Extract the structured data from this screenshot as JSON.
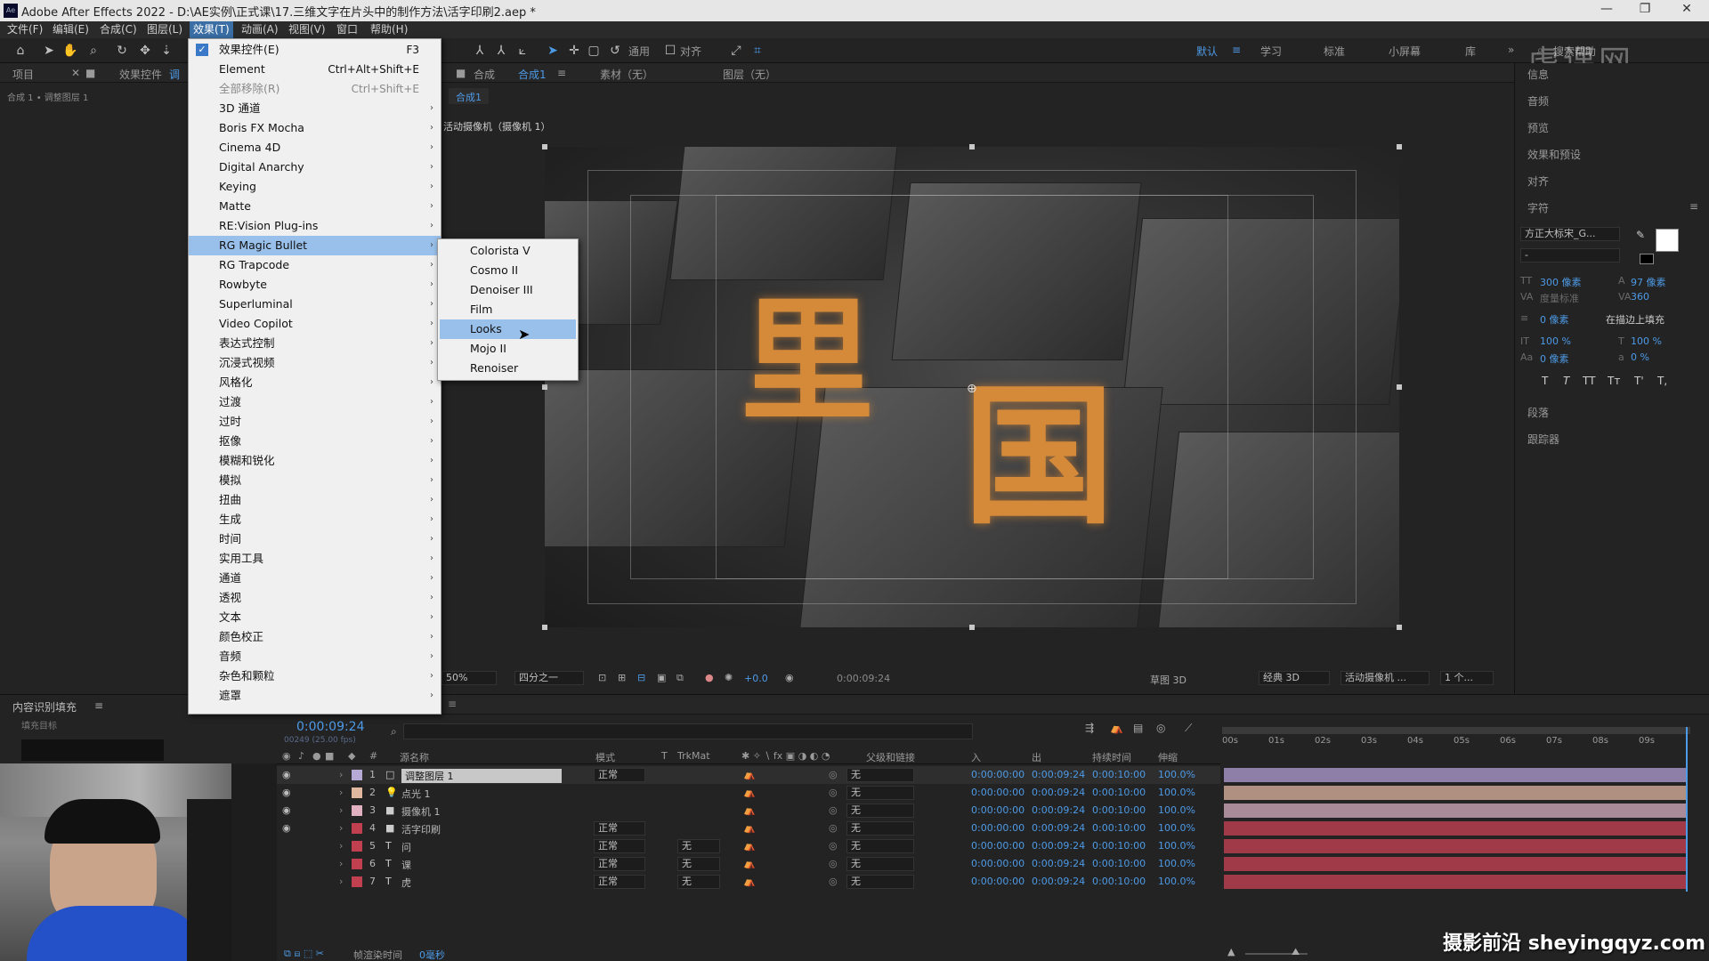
{
  "window": {
    "title": "Adobe After Effects 2022 - D:\\AE实例\\正式课\\17.三维文字在片头中的制作方法\\活字印刷2.aep *",
    "controls": [
      "—",
      "❐",
      "✕"
    ]
  },
  "menubar": {
    "items": [
      "文件(F)",
      "编辑(E)",
      "合成(C)",
      "图层(L)",
      "效果(T)",
      "动画(A)",
      "视图(V)",
      "窗口",
      "帮助(H)"
    ],
    "active_index": 4
  },
  "toolbar": {
    "snap_general": "通用",
    "snap_align": "对齐",
    "workspaces": [
      "默认",
      "学习",
      "标准",
      "小屏幕",
      "库"
    ],
    "active_workspace": "默认",
    "search_help": "搜索帮助"
  },
  "project_panel": {
    "tab_project": "项目",
    "tab_effects": "效果控件",
    "tab_effects_suffix": "调",
    "breadcrumb": "合成 1 • 调整图层 1"
  },
  "comp_panel": {
    "tab_label": "合成",
    "tab_name": "合成1",
    "footage_tab": "素材（无）",
    "layer_tab": "图层（无）",
    "sub_tab": "合成1",
    "camera_label": "活动摄像机（摄像机 1）",
    "viewer_image_glyphs": [
      "里",
      "国"
    ]
  },
  "effect_menu": {
    "items": [
      {
        "label": "效果控件(E)",
        "shortcut": "F3",
        "checked": true
      },
      {
        "label": "Element",
        "shortcut": "Ctrl+Alt+Shift+E"
      },
      {
        "label": "全部移除(R)",
        "shortcut": "Ctrl+Shift+E",
        "disabled": true
      },
      {
        "label": "3D 通道",
        "sub": true
      },
      {
        "label": "Boris FX Mocha",
        "sub": true
      },
      {
        "label": "Cinema 4D",
        "sub": true
      },
      {
        "label": "Digital Anarchy",
        "sub": true
      },
      {
        "label": "Keying",
        "sub": true
      },
      {
        "label": "Matte",
        "sub": true
      },
      {
        "label": "RE:Vision Plug-ins",
        "sub": true
      },
      {
        "label": "RG Magic Bullet",
        "sub": true,
        "selected": true
      },
      {
        "label": "RG Trapcode",
        "sub": true
      },
      {
        "label": "Rowbyte",
        "sub": true
      },
      {
        "label": "Superluminal",
        "sub": true
      },
      {
        "label": "Video Copilot",
        "sub": true
      },
      {
        "label": "表达式控制",
        "sub": true
      },
      {
        "label": "沉浸式视频",
        "sub": true
      },
      {
        "label": "风格化",
        "sub": true
      },
      {
        "label": "过渡",
        "sub": true
      },
      {
        "label": "过时",
        "sub": true
      },
      {
        "label": "抠像",
        "sub": true
      },
      {
        "label": "模糊和锐化",
        "sub": true
      },
      {
        "label": "模拟",
        "sub": true
      },
      {
        "label": "扭曲",
        "sub": true
      },
      {
        "label": "生成",
        "sub": true
      },
      {
        "label": "时间",
        "sub": true
      },
      {
        "label": "实用工具",
        "sub": true
      },
      {
        "label": "通道",
        "sub": true
      },
      {
        "label": "透视",
        "sub": true
      },
      {
        "label": "文本",
        "sub": true
      },
      {
        "label": "颜色校正",
        "sub": true
      },
      {
        "label": "音频",
        "sub": true
      },
      {
        "label": "杂色和颗粒",
        "sub": true
      },
      {
        "label": "遮罩",
        "sub": true
      }
    ]
  },
  "submenu": {
    "items": [
      "Colorista V",
      "Cosmo II",
      "Denoiser III",
      "Film",
      "Looks",
      "Mojo II",
      "Renoiser"
    ],
    "selected": "Looks"
  },
  "viewer_bar": {
    "zoom": "50%",
    "resolution": "四分之一",
    "exposure": "+0.0",
    "timecode": "0:00:09:24",
    "draft3d": "草图 3D",
    "renderer": "经典 3D",
    "view": "活动摄像机 ...",
    "views_count": "1 个..."
  },
  "right_panel": {
    "items": [
      "信息",
      "音频",
      "预览",
      "效果和预设",
      "对齐",
      "字符",
      "段落",
      "跟踪器"
    ],
    "font_name": "方正大标宋_G...",
    "font_style": "-",
    "font_size": "300 像素",
    "leading": "97 像素",
    "kerning": "度量标准",
    "tracking": "360",
    "stroke_width": "0 像素",
    "stroke_mode": "在描边上填充",
    "vscale": "100 %",
    "hscale": "100 %",
    "baseline": "0 像素",
    "tsume": "0 %",
    "styles": [
      "T",
      "T",
      "TT",
      "Tт",
      "T'",
      "T,"
    ]
  },
  "content_fill": {
    "title": "内容识别填充",
    "subtitle": "填充目标"
  },
  "timeline": {
    "timecode": "0:00:09:24",
    "fps_note": "00249 (25.00 fps)",
    "headers": {
      "name": "源名称",
      "mode": "模式",
      "t": "T",
      "trkmat": "TrkMat",
      "parent": "父级和链接",
      "in": "入",
      "out": "出",
      "duration": "持续时间",
      "stretch": "伸缩"
    },
    "ruler": [
      "00s",
      "01s",
      "02s",
      "03s",
      "04s",
      "05s",
      "06s",
      "07s",
      "08s",
      "09s"
    ],
    "layers": [
      {
        "num": "1",
        "name": "调整图层 1",
        "mode": "正常",
        "trkmat": "",
        "parent": "无",
        "in": "0:00:00:00",
        "out": "0:00:09:24",
        "dur": "0:00:10:00",
        "stretch": "100.0%",
        "color": "#b7a9d6",
        "bar": "#8d7fa8",
        "icon": "□"
      },
      {
        "num": "2",
        "name": "点光 1",
        "mode": "",
        "trkmat": "",
        "parent": "无",
        "in": "0:00:00:00",
        "out": "0:00:09:24",
        "dur": "0:00:10:00",
        "stretch": "100.0%",
        "color": "#e0b8a0",
        "bar": "#b09080",
        "icon": "💡"
      },
      {
        "num": "3",
        "name": "摄像机 1",
        "mode": "",
        "trkmat": "",
        "parent": "无",
        "in": "0:00:00:00",
        "out": "0:00:09:24",
        "dur": "0:00:10:00",
        "stretch": "100.0%",
        "color": "#e0b0c0",
        "bar": "#a88a98",
        "icon": "■"
      },
      {
        "num": "4",
        "name": "活字印刷",
        "mode": "正常",
        "trkmat": "",
        "parent": "无",
        "in": "0:00:00:00",
        "out": "0:00:09:24",
        "dur": "0:00:10:00",
        "stretch": "100.0%",
        "color": "#c04050",
        "bar": "#a03a48",
        "icon": "■"
      },
      {
        "num": "5",
        "name": "问",
        "mode": "正常",
        "trkmat": "无",
        "parent": "无",
        "in": "0:00:00:00",
        "out": "0:00:09:24",
        "dur": "0:00:10:00",
        "stretch": "100.0%",
        "color": "#c04050",
        "bar": "#a03a48",
        "icon": "T"
      },
      {
        "num": "6",
        "name": "课",
        "mode": "正常",
        "trkmat": "无",
        "parent": "无",
        "in": "0:00:00:00",
        "out": "0:00:09:24",
        "dur": "0:00:10:00",
        "stretch": "100.0%",
        "color": "#c04050",
        "bar": "#a03a48",
        "icon": "T"
      },
      {
        "num": "7",
        "name": "虎",
        "mode": "正常",
        "trkmat": "无",
        "parent": "无",
        "in": "0:00:00:00",
        "out": "0:00:09:24",
        "dur": "0:00:10:00",
        "stretch": "100.0%",
        "color": "#c04050",
        "bar": "#a03a48",
        "icon": "T"
      }
    ],
    "footer": {
      "render_label": "帧渲染时间",
      "render_value": "0毫秒"
    }
  },
  "watermark": {
    "text": "摄影前沿 sheyingqyz.com",
    "corner_logo": "虎课网"
  }
}
